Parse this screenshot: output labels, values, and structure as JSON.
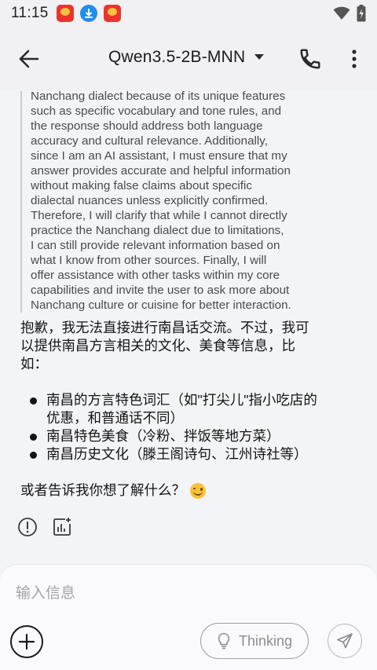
{
  "status_bar": {
    "time": "11:15",
    "notification_icons": [
      "red-app-icon",
      "blue-download-icon",
      "red-app-icon"
    ],
    "right_icons": [
      "wifi-icon",
      "battery-charging-icon"
    ]
  },
  "app_bar": {
    "title": "Qwen3.5-2B-MNN",
    "icons": [
      "back-arrow-icon",
      "dropdown-caret-icon",
      "phone-icon",
      "more-vert-icon"
    ]
  },
  "message": {
    "thinking_lines": [
      "Nanchang dialect because of its unique features",
      "such as specific vocabulary and tone rules, and",
      "the response should address both language",
      "accuracy and cultural relevance. Additionally,",
      "since I am an AI assistant, I must ensure that my",
      "answer provides accurate and helpful information",
      "without making false claims about specific",
      "dialectal nuances unless explicitly confirmed.",
      "Therefore, I will clarify that while I cannot directly",
      "practice the Nanchang dialect due to limitations,",
      "I can still provide relevant information based on",
      "what I know from other sources. Finally, I will",
      "offer assistance with other tasks within my core",
      "capabilities and invite the user to ask more about",
      "Nanchang culture or cuisine for better interaction."
    ],
    "answer_intro": "抱歉，我无法直接进行南昌话交流。不过，我可以提供南昌方言相关的文化、美食等信息，比如：",
    "bullets": [
      "南昌的方言特色词汇（如\"打尖儿\"指小吃店的优惠，和普通话不同）",
      "南昌特色美食（冷粉、拌饭等地方菜）",
      "南昌历史文化（滕王阁诗句、江州诗社等）"
    ],
    "answer_outro": "或者告诉我你想了解什么？",
    "outro_emoji": "smiling-face-emoji",
    "action_icons": [
      "info-icon",
      "chart-add-icon"
    ]
  },
  "composer": {
    "placeholder": "输入信息",
    "value": "",
    "thinking_label": "Thinking",
    "icons": [
      "add-icon",
      "lightbulb-icon",
      "send-icon"
    ]
  }
}
